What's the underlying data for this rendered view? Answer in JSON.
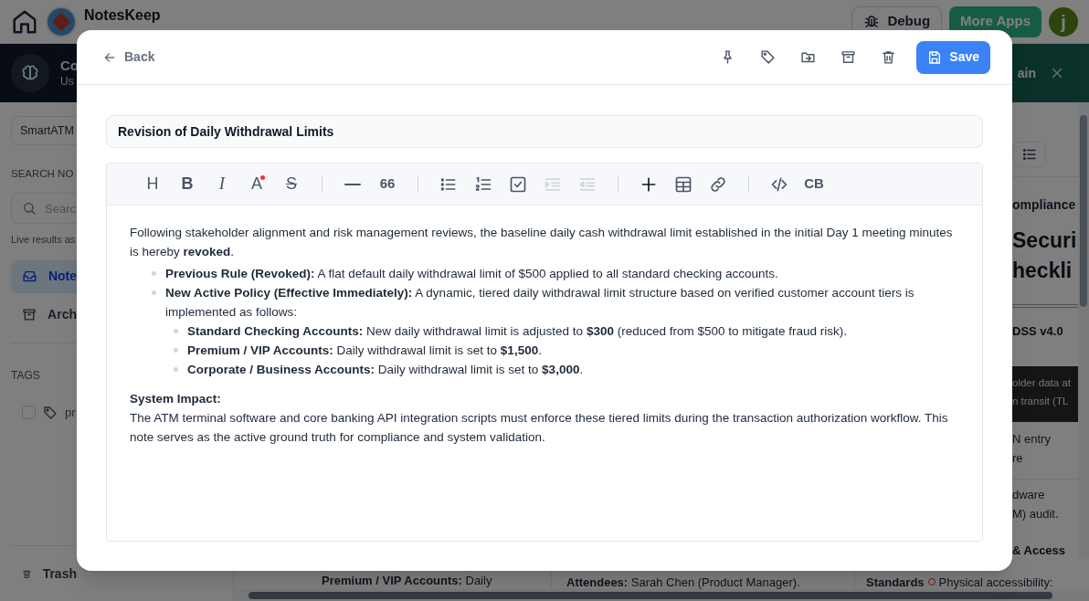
{
  "app_bar": {
    "title": "NotesKeep",
    "debug": "Debug",
    "more_apps": "More Apps",
    "avatar": "j"
  },
  "banner": {
    "title": "Co",
    "subtitle": "Us",
    "right_text": "ain"
  },
  "sidebar": {
    "project": "SmartATM",
    "search_heading": "SEARCH NO",
    "search_placeholder": "Searc",
    "search_hint": "Live results as",
    "nav": [
      {
        "label": "Note",
        "kind": "inbox",
        "selected": true
      },
      {
        "label": "Arch",
        "kind": "archive",
        "selected": false
      }
    ],
    "tags_heading": "TAGS",
    "tags": [
      {
        "label": "pr",
        "checked": false
      }
    ],
    "trash": "Trash"
  },
  "right_panel": {
    "lines": [
      {
        "kind": "subtitle",
        "text": "ompliance"
      },
      {
        "kind": "heading",
        "text": "Securi"
      },
      {
        "kind": "heading",
        "text": "heckli"
      },
      {
        "kind": "bold",
        "text": "DSS v4.0"
      },
      {
        "kind": "dark",
        "text": "older data at"
      },
      {
        "kind": "dark",
        "text": "n transit (TL"
      },
      {
        "kind": "plain",
        "text": "N entry"
      },
      {
        "kind": "plain",
        "text": "re"
      },
      {
        "kind": "plain",
        "text": "dware"
      },
      {
        "kind": "plain",
        "text": "M) audit."
      },
      {
        "kind": "bold",
        "text": "& Access"
      }
    ]
  },
  "bottom_strip": {
    "column_1": "**Premium / VIP Accounts:** Daily",
    "column_2": "**Attendees:** Sarah Chen (Product Manager).",
    "column_3_label": "Standards",
    "column_3_text": "Physical accessibility:"
  },
  "modal": {
    "back": "Back",
    "save": "Save",
    "title": "Revision of Daily Withdrawal Limits",
    "toolbar": [
      {
        "kind": "text",
        "label": "H",
        "disabled": false
      },
      {
        "kind": "bold",
        "label": "B",
        "disabled": false
      },
      {
        "kind": "italic",
        "label": "I",
        "disabled": false
      },
      {
        "kind": "color",
        "label": "A",
        "disabled": false
      },
      {
        "kind": "strike",
        "label": "S",
        "disabled": false
      },
      {
        "kind": "divider"
      },
      {
        "kind": "rule",
        "disabled": false
      },
      {
        "kind": "text",
        "label": "66",
        "disabled": false
      },
      {
        "kind": "divider"
      },
      {
        "kind": "bullets",
        "disabled": false
      },
      {
        "kind": "numbers",
        "disabled": false
      },
      {
        "kind": "checklist",
        "disabled": false
      },
      {
        "kind": "indent",
        "disabled": true
      },
      {
        "kind": "outdent",
        "disabled": true
      },
      {
        "kind": "divider"
      },
      {
        "kind": "plus",
        "disabled": false
      },
      {
        "kind": "table",
        "disabled": false
      },
      {
        "kind": "link",
        "disabled": false
      },
      {
        "kind": "divider"
      },
      {
        "kind": "code",
        "disabled": false
      },
      {
        "kind": "text",
        "label": "CB",
        "disabled": false
      }
    ],
    "content": [
      {
        "kind": "paragraph",
        "text": "Following stakeholder alignment and risk management reviews, the baseline daily cash withdrawal limit established in the initial Day 1 meeting minutes is hereby **revoked**."
      },
      {
        "kind": "list",
        "items": [
          {
            "text": "**Previous Rule (Revoked):** A flat default daily withdrawal limit of $500 applied to all standard checking accounts."
          },
          {
            "text": "**New Active Policy (Effective Immediately):** A dynamic, tiered daily withdrawal limit structure based on verified customer account tiers is implemented as follows:",
            "children": [
              {
                "text": "**Standard Checking Accounts:** New daily withdrawal limit is adjusted to **$300** (reduced from $500 to mitigate fraud risk)."
              },
              {
                "text": "**Premium / VIP Accounts:** Daily withdrawal limit is set to **$1,500**."
              },
              {
                "text": "**Corporate / Business Accounts:** Daily withdrawal limit is set to **$3,000**."
              }
            ]
          }
        ]
      },
      {
        "kind": "heading",
        "text": "System Impact:"
      },
      {
        "kind": "paragraph",
        "text": "The ATM terminal software and core banking API integration scripts must enforce these tiered limits during the transaction authorization workflow. This note serves as the active ground truth for compliance and system validation."
      }
    ]
  }
}
